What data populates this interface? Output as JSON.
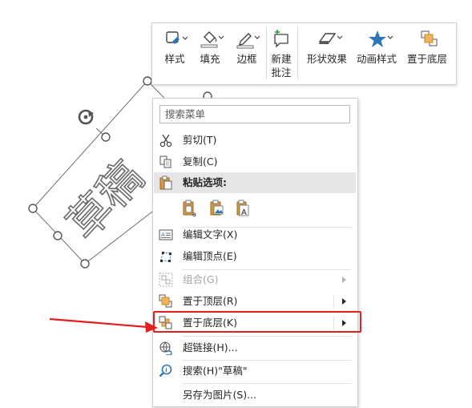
{
  "canvas": {
    "shape_text": "草稿",
    "rotate_handle_icon": "rotate-handle-icon",
    "handle_color": "#555555"
  },
  "toolbar": {
    "style_label": "样式",
    "fill_label": "填充",
    "border_label": "边框",
    "new_comment_line1": "新建",
    "new_comment_line2": "批注",
    "shape_effects_label": "形状效果",
    "animation_styles_label": "动画样式",
    "send_to_back_label": "置于底层"
  },
  "menu": {
    "search_placeholder": "搜索菜单",
    "items": [
      {
        "label": "剪切(T)",
        "icon": "scissors-icon"
      },
      {
        "label": "复制(C)",
        "icon": "copy-icon"
      },
      {
        "label": "粘贴选项:",
        "icon": "clipboard-icon"
      },
      {
        "label": "编辑文字(X)",
        "icon": "edit-text-icon"
      },
      {
        "label": "编辑顶点(E)",
        "icon": "edit-points-icon"
      },
      {
        "label": "组合(G)",
        "icon": "group-icon",
        "disabled": true,
        "submenu": true
      },
      {
        "label": "置于顶层(R)",
        "icon": "bring-to-front-icon",
        "submenu": true
      },
      {
        "label": "置于底层(K)",
        "icon": "send-to-back-icon",
        "submenu": true
      },
      {
        "label": "超链接(H)...",
        "icon": "hyperlink-icon"
      },
      {
        "label": "搜索(H)\"草稿\"",
        "icon": "smart-lookup-icon"
      },
      {
        "label": "另存为图片(S)...",
        "icon": ""
      }
    ],
    "paste_options": [
      "paste-keep-format-icon",
      "paste-picture-icon",
      "paste-text-only-icon"
    ]
  },
  "colors": {
    "accent_blue": "#2e75b6",
    "highlight_red": "#e3201f",
    "disabled_gray": "#a6a6a6"
  }
}
